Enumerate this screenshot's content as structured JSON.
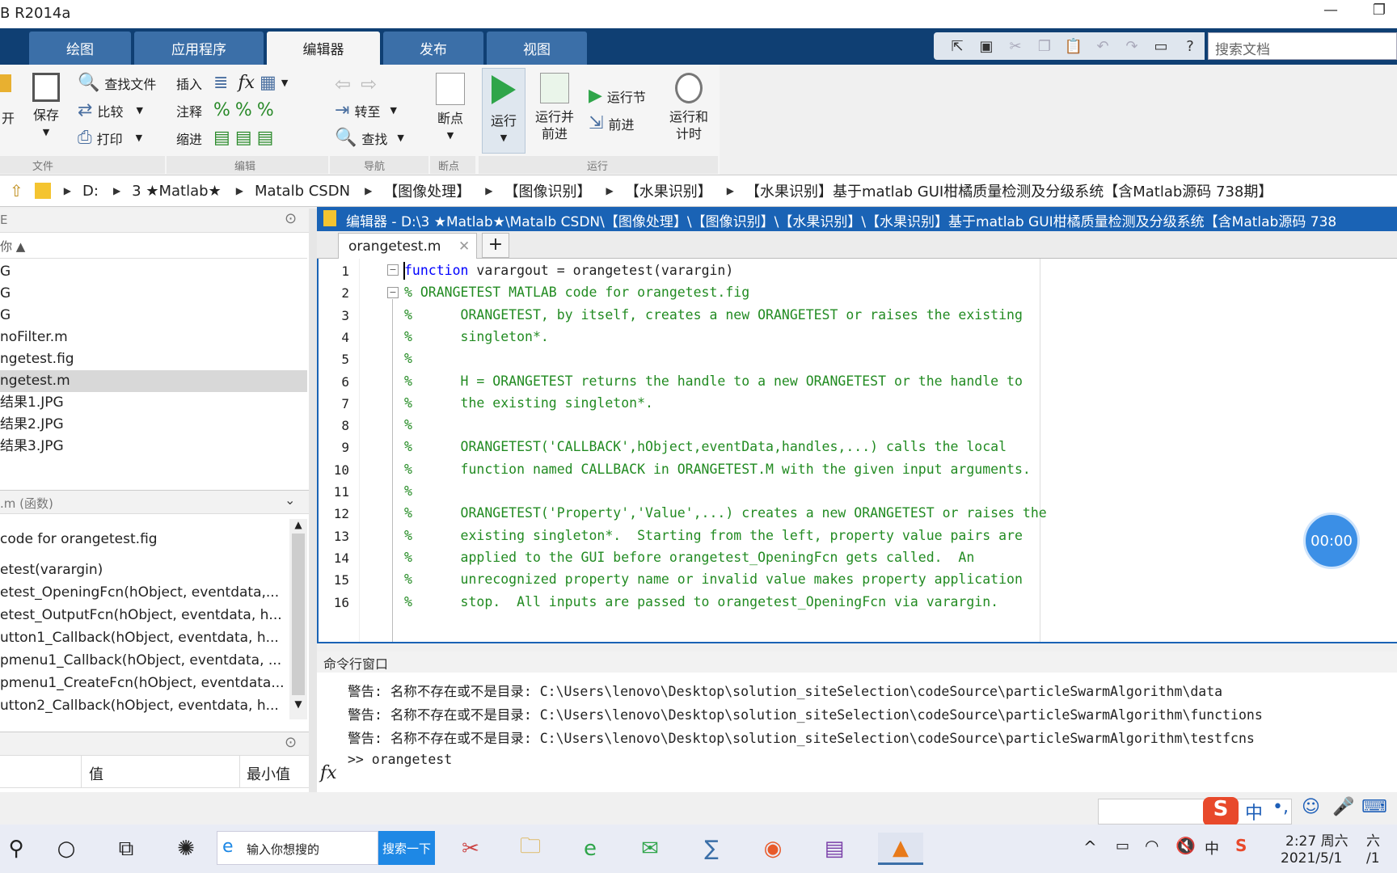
{
  "window": {
    "title": "B R2014a",
    "minimize": "—",
    "restore": "❐"
  },
  "tabs": [
    "绘图",
    "应用程序",
    "编辑器",
    "发布",
    "视图"
  ],
  "quickbar": {
    "search_placeholder": "搜索文档"
  },
  "ribbon": {
    "file": {
      "open": "开",
      "save": "保存",
      "find_files": "查找文件",
      "compare": "比较",
      "print": "打印",
      "group": "文件"
    },
    "edit": {
      "insert": "插入",
      "comment": "注释",
      "indent": "缩进",
      "fx": "fx",
      "group": "编辑"
    },
    "nav": {
      "goto": "转至",
      "find": "查找",
      "group": "导航"
    },
    "breakpoints": {
      "label": "断点",
      "group": "断点"
    },
    "run": {
      "run": "运行",
      "run_advance_1": "运行并",
      "run_advance_2": "前进",
      "run_section": "运行节",
      "advance": "前进",
      "run_time_1": "运行和",
      "run_time_2": "计时",
      "group": "运行"
    }
  },
  "address": [
    "D:",
    "3 ★Matlab★",
    "Matalb CSDN",
    "【图像处理】",
    "【图像识别】",
    "【水果识别】",
    "【水果识别】基于matlab GUI柑橘质量检测及分级系统【含Matlab源码 738期】"
  ],
  "left_panel": {
    "header1": "E",
    "col_name": "你 ▲",
    "files": [
      "G",
      "G",
      "G",
      "noFilter.m",
      "ngetest.fig",
      "ngetest.m",
      "结果1.JPG",
      "结果2.JPG",
      "结果3.JPG"
    ],
    "details_header": ".m (函数)",
    "functions": [
      "code for orangetest.fig",
      "etest(varargin)",
      "etest_OpeningFcn(hObject, eventdata,...",
      "etest_OutputFcn(hObject, eventdata, h...",
      "utton1_Callback(hObject, eventdata, h...",
      "pmenu1_Callback(hObject, eventdata, ...",
      "pmenu1_CreateFcn(hObject, eventdata...",
      "utton2_Callback(hObject, eventdata, h..."
    ],
    "workspace_col_value": "值",
    "workspace_col_min": "最小值"
  },
  "editor": {
    "title": "编辑器 - D:\\3 ★Matlab★\\Matalb CSDN\\【图像处理】\\【图像识别】\\【水果识别】\\【水果识别】基于matlab GUI柑橘质量检测及分级系统【含Matlab源码 738",
    "tab": "orangetest.m",
    "line_numbers": [
      "1",
      "2",
      "3",
      "4",
      "5",
      "6",
      "7",
      "8",
      "9",
      "10",
      "11",
      "12",
      "13",
      "14",
      "15",
      "16"
    ],
    "lines": [
      "function varargout = orangetest(varargin)",
      "% ORANGETEST MATLAB code for orangetest.fig",
      "%      ORANGETEST, by itself, creates a new ORANGETEST or raises the existing",
      "%      singleton*.",
      "%",
      "%      H = ORANGETEST returns the handle to a new ORANGETEST or the handle to",
      "%      the existing singleton*.",
      "%",
      "%      ORANGETEST('CALLBACK',hObject,eventData,handles,...) calls the local",
      "%      function named CALLBACK in ORANGETEST.M with the given input arguments.",
      "%",
      "%      ORANGETEST('Property','Value',...) creates a new ORANGETEST or raises the",
      "%      existing singleton*.  Starting from the left, property value pairs are",
      "%      applied to the GUI before orangetest_OpeningFcn gets called.  An",
      "%      unrecognized property name or invalid value makes property application",
      "%      stop.  All inputs are passed to orangetest_OpeningFcn via varargin."
    ],
    "line1_kw": "function",
    "line1_rest": " varargout = orangetest(varargin)"
  },
  "timer": "00:00",
  "command_window": {
    "title": "命令行窗口",
    "lines": [
      "警告: 名称不存在或不是目录: C:\\Users\\lenovo\\Desktop\\solution_siteSelection\\codeSource\\particleSwarmAlgorithm\\data",
      "警告: 名称不存在或不是目录: C:\\Users\\lenovo\\Desktop\\solution_siteSelection\\codeSource\\particleSwarmAlgorithm\\functions",
      "警告: 名称不存在或不是目录: C:\\Users\\lenovo\\Desktop\\solution_siteSelection\\codeSource\\particleSwarmAlgorithm\\testfcns",
      ">> orangetest"
    ],
    "fx": "fx"
  },
  "taskbar": {
    "search_text": "输入你想搜的",
    "search_button": "搜索一下",
    "time": "2:27 周六",
    "date": "2021/5/1",
    "extra1": "六",
    "extra2": "/1",
    "ime_zh": "中"
  }
}
